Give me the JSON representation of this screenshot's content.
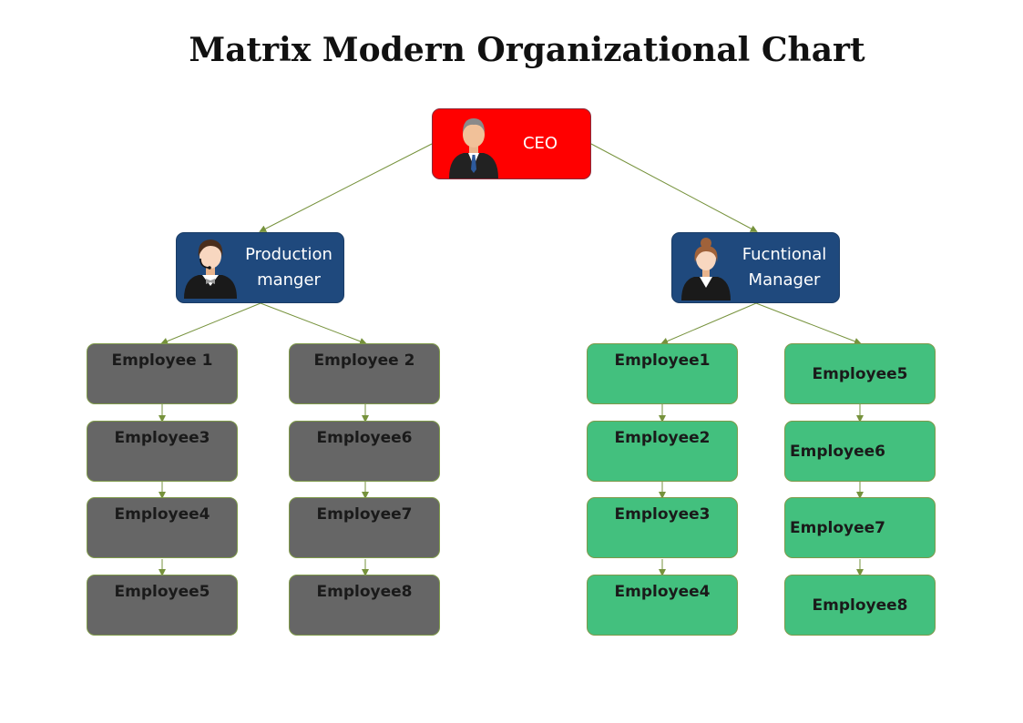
{
  "title": "Matrix Modern Organizational Chart",
  "colors": {
    "ceo": "#ff0000",
    "manager": "#1f497d",
    "production_team": "#666666",
    "functional_team": "#43c07e",
    "connector": "#76923c"
  },
  "ceo": {
    "label": "CEO",
    "icon": "businessman-avatar-icon"
  },
  "managers": [
    {
      "label_line1": "Production",
      "label_line2": "manger",
      "icon": "support-agent-avatar-icon"
    },
    {
      "label_line1": "Fucntional",
      "label_line2": "Manager",
      "icon": "businesswoman-avatar-icon"
    }
  ],
  "production_columns": [
    [
      "Employee 1",
      "Employee3",
      "Employee4",
      "Employee5"
    ],
    [
      "Employee 2",
      "Employee6",
      "Employee7",
      "Employee8"
    ]
  ],
  "functional_columns": [
    [
      "Employee1",
      "Employee2",
      "Employee3",
      "Employee4"
    ],
    [
      "Employee5",
      "Employee6",
      "Employee7",
      "Employee8"
    ]
  ]
}
